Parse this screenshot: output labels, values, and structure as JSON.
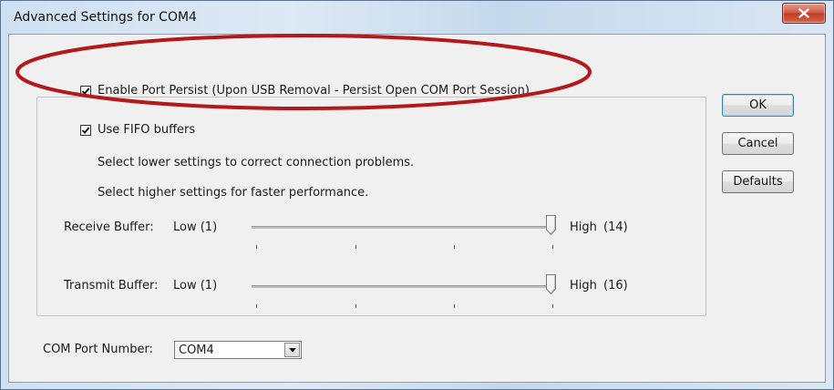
{
  "window": {
    "title": "Advanced Settings for COM4"
  },
  "options": {
    "port_persist": {
      "label": "Enable Port Persist (Upon USB Removal - Persist Open COM Port Session)",
      "checked": true
    },
    "fifo": {
      "label": "Use FIFO buffers",
      "checked": true
    }
  },
  "hints": {
    "lower": "Select lower settings to correct connection problems.",
    "higher": "Select higher settings for faster performance."
  },
  "receive": {
    "label": "Receive Buffer:",
    "low": "Low (1)",
    "high": "High",
    "value": "(14)"
  },
  "transmit": {
    "label": "Transmit Buffer:",
    "low": "Low (1)",
    "high": "High",
    "value": "(16)"
  },
  "com_port": {
    "label": "COM Port Number:",
    "value": "COM4"
  },
  "buttons": {
    "ok": "OK",
    "cancel": "Cancel",
    "defaults": "Defaults"
  },
  "icons": {
    "close": "close-icon",
    "check": "check-icon",
    "dropdown": "chevron-down-icon"
  },
  "colors": {
    "highlight_ellipse": "#b3181b",
    "close_button": "#c94a33"
  }
}
